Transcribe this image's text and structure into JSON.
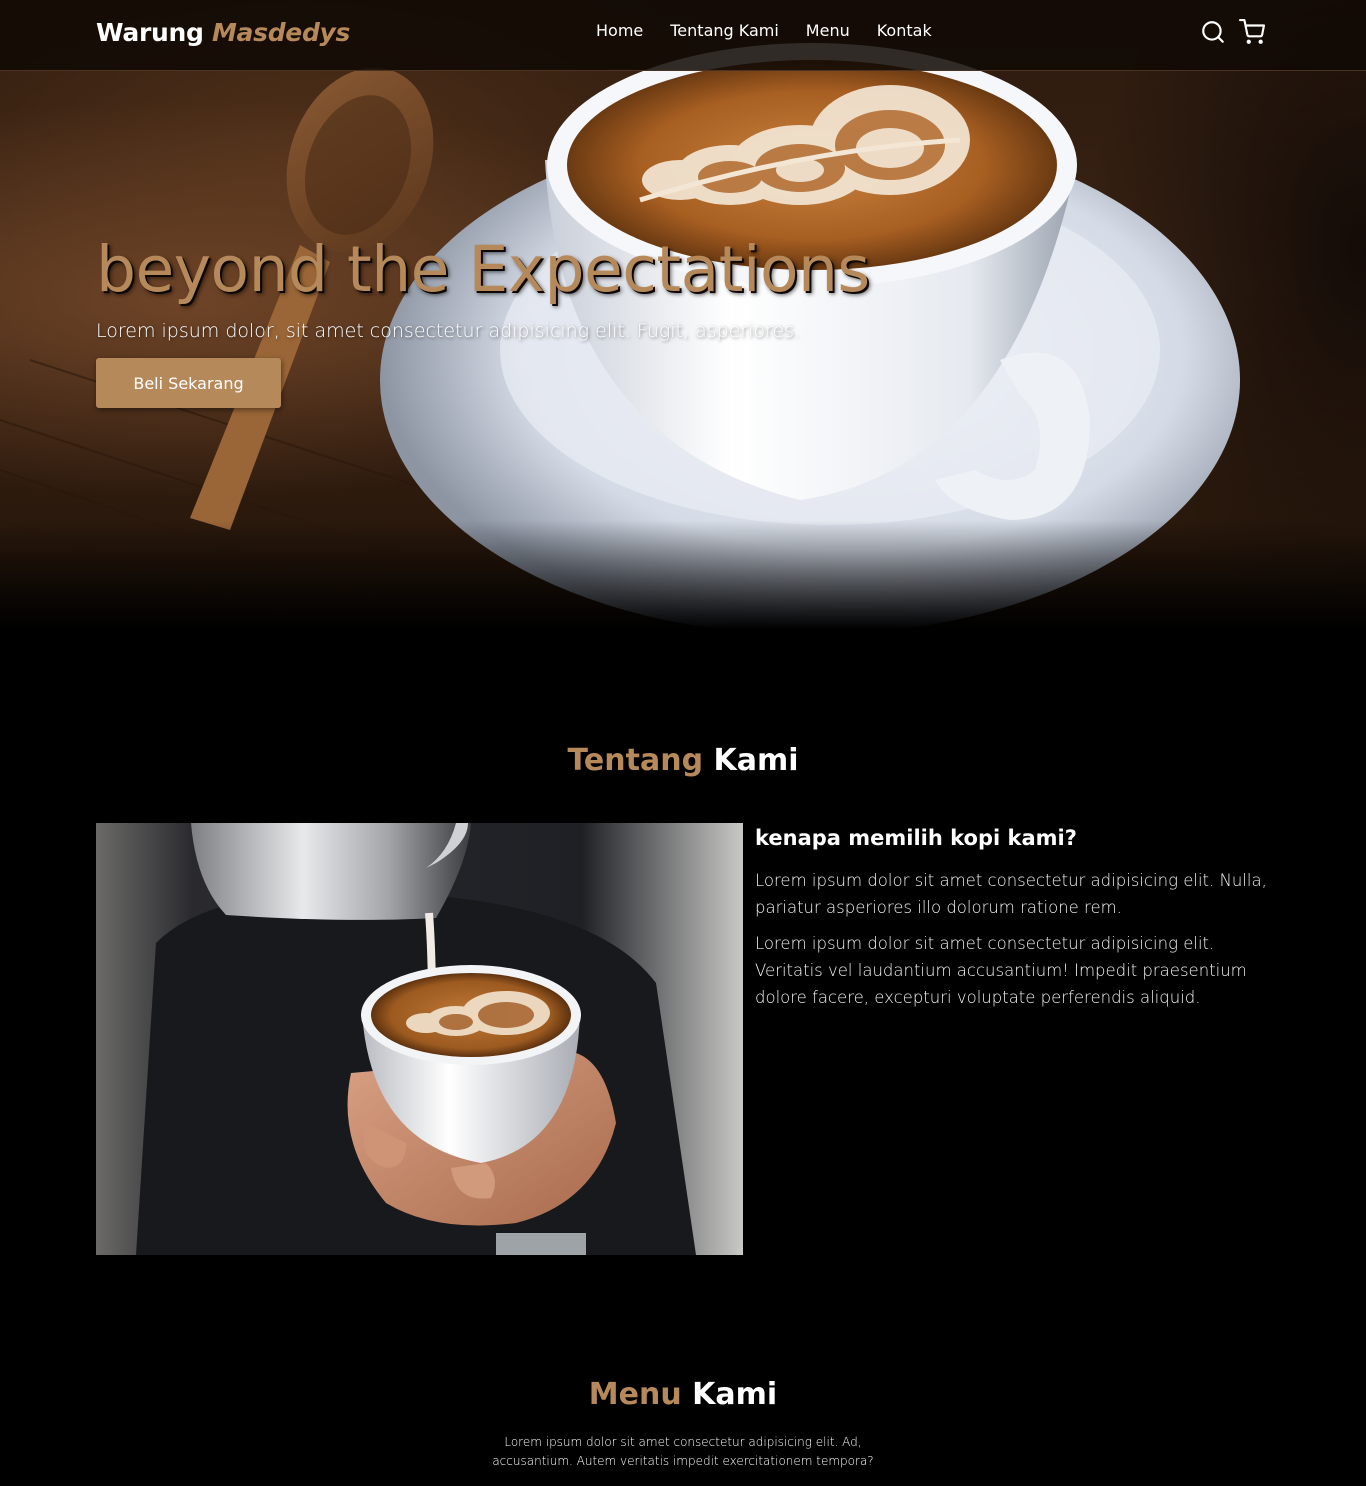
{
  "navbar": {
    "logo_main": "Warung ",
    "logo_accent": "Masdedys",
    "links": [
      "Home",
      "Tentang Kami",
      "Menu",
      "Kontak"
    ],
    "icons": [
      "search-icon",
      "shopping-cart-icon"
    ]
  },
  "hero": {
    "title_main": "beyond the ",
    "title_accent": "Expectations",
    "subtitle": "Lorem ipsum dolor, sit amet consectetur adipisicing elit. Fugit, asperiores.",
    "cta_label": "Beli Sekarang"
  },
  "about": {
    "title_accent": "Tentang",
    "title_main": "Kami",
    "heading": "kenapa memilih kopi kami?",
    "paragraphs": [
      "Lorem ipsum dolor sit amet consectetur adipisicing elit. Nulla, pariatur asperiores illo dolorum ratione rem.",
      "Lorem ipsum dolor sit amet consectetur adipisicing elit. Veritatis vel laudantium accusantium! Impedit praesentium dolore facere, excepturi voluptate perferendis aliquid."
    ]
  },
  "menu": {
    "title_accent": "Menu",
    "title_main": "Kami",
    "subtitle": "Lorem ipsum dolor sit amet consectetur adipisicing elit. Ad, accusantium. Autem veritatis impedit exercitationem tempora?"
  },
  "colors": {
    "accent": "#b6895b",
    "background": "#000000",
    "text": "#ffffff"
  }
}
